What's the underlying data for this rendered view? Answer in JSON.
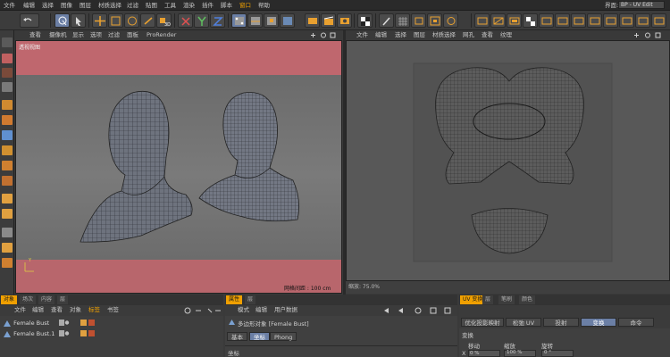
{
  "menubar": {
    "items": [
      "文件",
      "编辑",
      "选择",
      "图像",
      "图层",
      "材质选择",
      "过滤",
      "贴图",
      "工具",
      "渲染",
      "插件",
      "脚本",
      "窗口",
      "帮助"
    ],
    "active_index": 12,
    "layout_label": "界面:",
    "layout_value": "BP - UV Edit"
  },
  "viewport": {
    "menu": [
      "查看",
      "摄像机",
      "显示",
      "选项",
      "过滤",
      "面板",
      "ProRender"
    ],
    "corner_label": "透视视图",
    "grid_label": "网格间距 : 100 cm",
    "axis_label": "Y"
  },
  "uv": {
    "menu": [
      "文件",
      "编辑",
      "选择",
      "图层",
      "材质选择",
      "网孔",
      "查看",
      "纹理"
    ],
    "status": "缩放: 75.0%"
  },
  "objects_panel": {
    "tabs": [
      "对象",
      "场次",
      "内容",
      "层"
    ],
    "menu": [
      "文件",
      "编辑",
      "查看",
      "对象",
      "标签",
      "书签"
    ],
    "rows": [
      "Female Bust",
      "Female Bust.1"
    ]
  },
  "attributes_panel": {
    "tabs": [
      "属性",
      "层"
    ],
    "menu": [
      "模式",
      "编辑",
      "用户数据"
    ],
    "object_title": "多边形对象 [Female Bust]",
    "subtabs": [
      "基本",
      "坐标",
      "Phong"
    ],
    "active_subtab": 1,
    "section": "坐标"
  },
  "uv_tools_panel": {
    "tabs": [
      "UV 变换",
      "层",
      "笔刷",
      "颜色"
    ],
    "buttons": [
      "优化投影映射",
      "松弛 UV",
      "投射",
      "变换",
      "命令"
    ],
    "active_button": 3,
    "section": "变换",
    "fields": [
      "移动",
      "缩放",
      "旋转"
    ],
    "axis_labels": [
      "X",
      "0 %",
      "100 %",
      "0 °"
    ]
  },
  "colors": {
    "accent": "#f0a000",
    "selection_blue": "#6b7fa5",
    "viewport_band": "#bf676e"
  }
}
